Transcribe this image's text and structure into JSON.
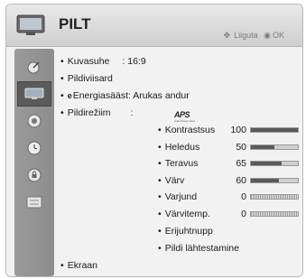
{
  "header": {
    "title": "PILT",
    "hint_move": "Liiguta",
    "hint_ok": "OK"
  },
  "sidebar": {
    "items": [
      {
        "icon": "satellite-dish-icon"
      },
      {
        "icon": "tv-screen-icon",
        "selected": true
      },
      {
        "icon": "speaker-icon"
      },
      {
        "icon": "clock-icon"
      },
      {
        "icon": "lock-icon"
      },
      {
        "icon": "options-icon"
      }
    ]
  },
  "menu": {
    "aspect_label": "Kuvasuhe",
    "aspect_value": ": 16:9",
    "wizard_label": "Pildiviisard",
    "energy_label": "Energiasääst: Arukas andur",
    "mode_label": "Pildirežiim",
    "mode_sep": ":",
    "aps_logo": "APS",
    "screen_label": "Ekraan"
  },
  "picture_settings": [
    {
      "label": "Kontrastsus",
      "value": "100",
      "level": 1.0
    },
    {
      "label": "Heledus",
      "value": "50",
      "level": 0.5
    },
    {
      "label": "Teravus",
      "value": "65",
      "level": 0.65
    },
    {
      "label": "Värv",
      "value": "60",
      "level": 0.6
    },
    {
      "label": "Varjund",
      "value": "0",
      "level": 0.5
    },
    {
      "label": "Värvitemp.",
      "value": "0",
      "level": 0.5
    }
  ],
  "sub_items": {
    "expert": "Erijuhtnupp",
    "reset": "Pildi lähtestamine"
  },
  "colors": {
    "panel_bg": "#f2f2f2",
    "header_bg": "#dcdcdc",
    "sidebar_bg": "#8d8d8d",
    "bar_fill": "#5a5a5a"
  }
}
